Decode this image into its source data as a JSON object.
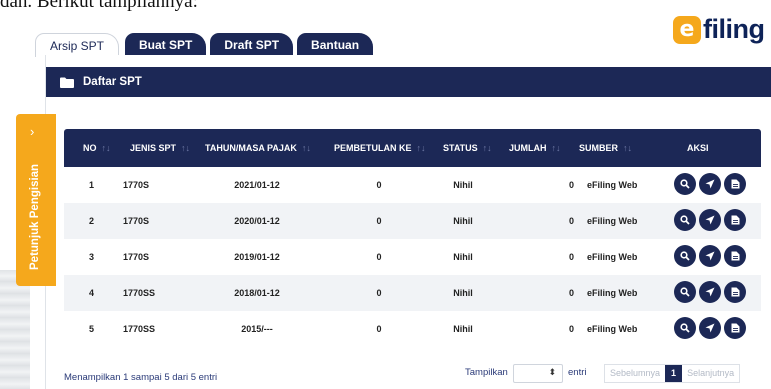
{
  "topline_text": "dah. Berikut tampilannya:",
  "logo": {
    "mark": "e",
    "text": "filing",
    "brand_color": "#f5a81c",
    "text_color": "#0e2358"
  },
  "tabs": [
    {
      "label": "Arsip SPT",
      "active": true
    },
    {
      "label": "Buat SPT",
      "active": false
    },
    {
      "label": "Draft SPT",
      "active": false
    },
    {
      "label": "Bantuan",
      "active": false
    }
  ],
  "panel": {
    "title": "Daftar SPT",
    "icon": "folder-icon"
  },
  "side_tab": {
    "label": "Petunjuk Pengisian",
    "chevron": "›",
    "color": "#f5a81c"
  },
  "table": {
    "headers": [
      "NO",
      "JENIS SPT",
      "TAHUN/MASA PAJAK",
      "PEMBETULAN KE",
      "STATUS",
      "JUMLAH",
      "SUMBER",
      "AKSI"
    ],
    "sort_glyph": "↑↓",
    "rows": [
      {
        "no": "1",
        "jenis": "1770S",
        "tahun": "2021/01-12",
        "pembetulan": "0",
        "status": "Nihil",
        "jumlah": "0",
        "sumber": "eFiling Web"
      },
      {
        "no": "2",
        "jenis": "1770S",
        "tahun": "2020/01-12",
        "pembetulan": "0",
        "status": "Nihil",
        "jumlah": "0",
        "sumber": "eFiling Web"
      },
      {
        "no": "3",
        "jenis": "1770S",
        "tahun": "2019/01-12",
        "pembetulan": "0",
        "status": "Nihil",
        "jumlah": "0",
        "sumber": "eFiling Web"
      },
      {
        "no": "4",
        "jenis": "1770SS",
        "tahun": "2018/01-12",
        "pembetulan": "0",
        "status": "Nihil",
        "jumlah": "0",
        "sumber": "eFiling Web"
      },
      {
        "no": "5",
        "jenis": "1770SS",
        "tahun": "2015/---",
        "pembetulan": "0",
        "status": "Nihil",
        "jumlah": "0",
        "sumber": "eFiling Web"
      }
    ],
    "action_icons": [
      "search-icon",
      "send-icon",
      "document-icon"
    ]
  },
  "footer": {
    "info": "Menampilkan 1 sampai 5 dari 5 entri",
    "show_label": "Tampilkan",
    "select_arrow": "⬍",
    "entri_label": "entri",
    "prev": "Sebelumnya",
    "page": "1",
    "next": "Selanjutnya"
  },
  "colors": {
    "navy": "#1c2856",
    "shade_row": "#f1f3f6"
  }
}
